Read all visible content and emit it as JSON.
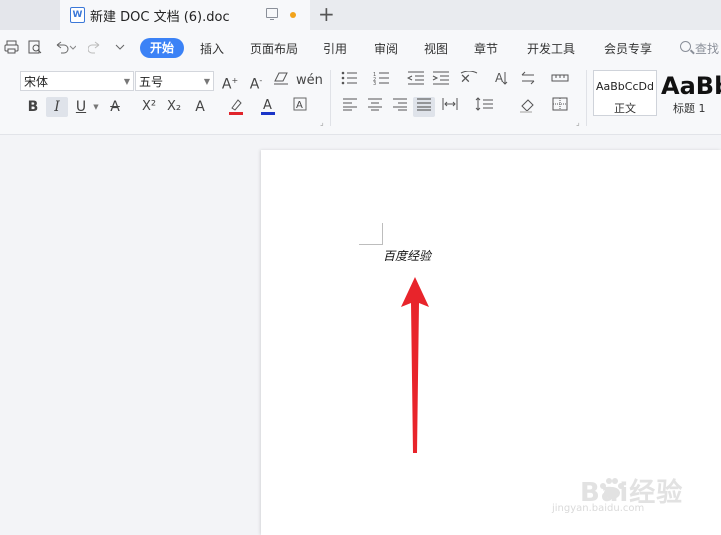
{
  "window": {
    "tab_title": "新建 DOC 文档 (6).doc",
    "file_icon_letter": "W",
    "new_tab_symbol": "+"
  },
  "menu": {
    "items": [
      "开始",
      "插入",
      "页面布局",
      "引用",
      "审阅",
      "视图",
      "章节",
      "开发工具",
      "会员专享"
    ],
    "active": "开始",
    "search_label": "查找"
  },
  "ribbon": {
    "font_name": "宋体",
    "font_size": "五号",
    "font_buttons": [
      "A⁺",
      "A⁻",
      "◇",
      "wén"
    ],
    "format_buttons": [
      "B",
      "I",
      "U",
      "A",
      "X²",
      "X₂",
      "A"
    ],
    "styles": {
      "normal_sample": "AaBbCcDd",
      "normal_label": "正文",
      "heading_sample": "AaBb",
      "heading_label": "标题 1"
    }
  },
  "document": {
    "text": "百度经验"
  },
  "watermark": {
    "brand": "Bai经验",
    "url": "jingyan.baidu.com"
  },
  "colors": {
    "accent": "#3b82f6",
    "unsaved_dot": "#f2a31a",
    "arrow": "#e8242b",
    "highlight": "#e0242b",
    "font_color": "#1a35c8"
  }
}
